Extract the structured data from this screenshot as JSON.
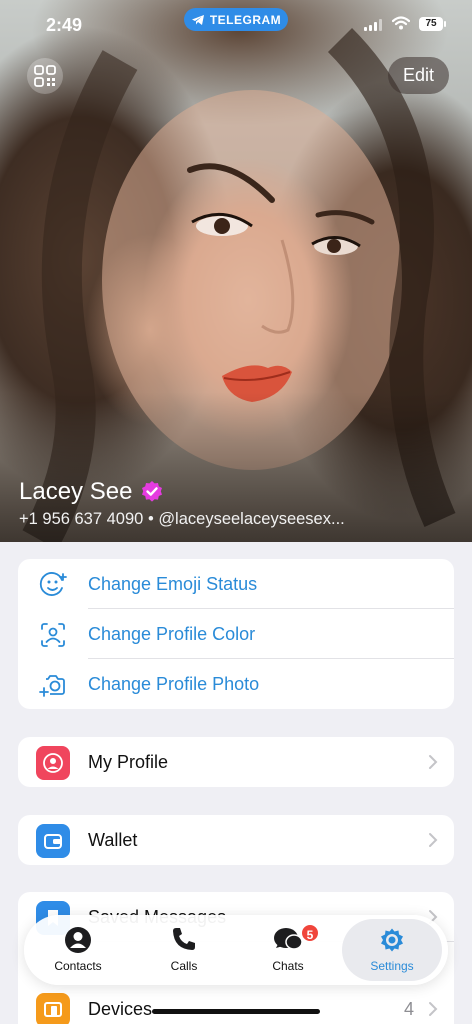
{
  "status_bar": {
    "time": "2:49",
    "pill": "TELEGRAM",
    "battery": "75"
  },
  "header": {
    "edit_label": "Edit",
    "name": "Lacey See",
    "phone": "+1 956 637 4090",
    "username": "@laceyseelaceyseesex...",
    "verified_color": "#e53be0"
  },
  "quick_actions": [
    {
      "label": "Change Emoji Status",
      "icon": "emoji-status-icon"
    },
    {
      "label": "Change Profile Color",
      "icon": "profile-color-icon"
    },
    {
      "label": "Change Profile Photo",
      "icon": "camera-add-icon"
    }
  ],
  "menu": {
    "my_profile": {
      "label": "My Profile",
      "color": "#f0455d"
    },
    "wallet": {
      "label": "Wallet",
      "color": "#2f8ce7"
    },
    "saved": {
      "label": "Saved Messages",
      "color": "#2f8ce7"
    },
    "devices": {
      "label": "Devices",
      "value": "4",
      "color": "#f59a1b"
    }
  },
  "tabs": [
    {
      "label": "Contacts"
    },
    {
      "label": "Calls"
    },
    {
      "label": "Chats",
      "badge": "5"
    },
    {
      "label": "Settings"
    }
  ],
  "accent_color": "#2a8bd8"
}
